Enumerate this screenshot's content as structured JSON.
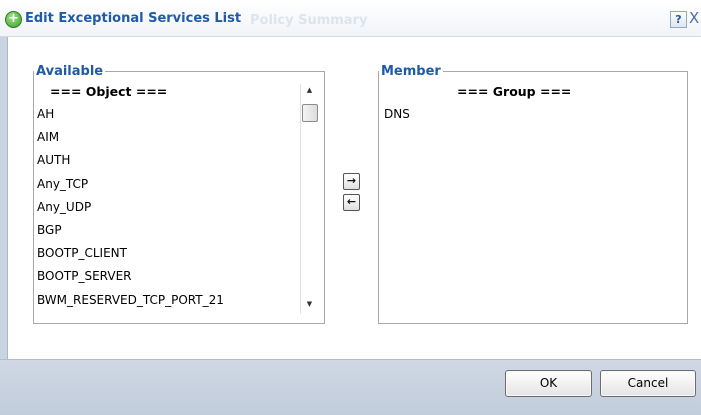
{
  "dialog": {
    "title": "Edit Exceptional Services List",
    "background_title": "Policy Summary",
    "help_label": "?",
    "close_label": "X"
  },
  "available": {
    "legend": "Available",
    "header": "=== Object ===",
    "items": [
      "AH",
      "AIM",
      "AUTH",
      "Any_TCP",
      "Any_UDP",
      "BGP",
      "BOOTP_CLIENT",
      "BOOTP_SERVER",
      "BWM_RESERVED_TCP_PORT_21"
    ]
  },
  "member": {
    "legend": "Member",
    "header": "=== Group ===",
    "items": [
      "DNS"
    ]
  },
  "controls": {
    "move_right": "→",
    "move_left": "←",
    "scroll_up": "▲",
    "scroll_down": "▼"
  },
  "footer": {
    "ok_label": "OK",
    "cancel_label": "Cancel"
  },
  "colors": {
    "title": "#1e5aa8",
    "footer_bg": "#c9d4e2",
    "accent_icon": "#3ea02a"
  }
}
